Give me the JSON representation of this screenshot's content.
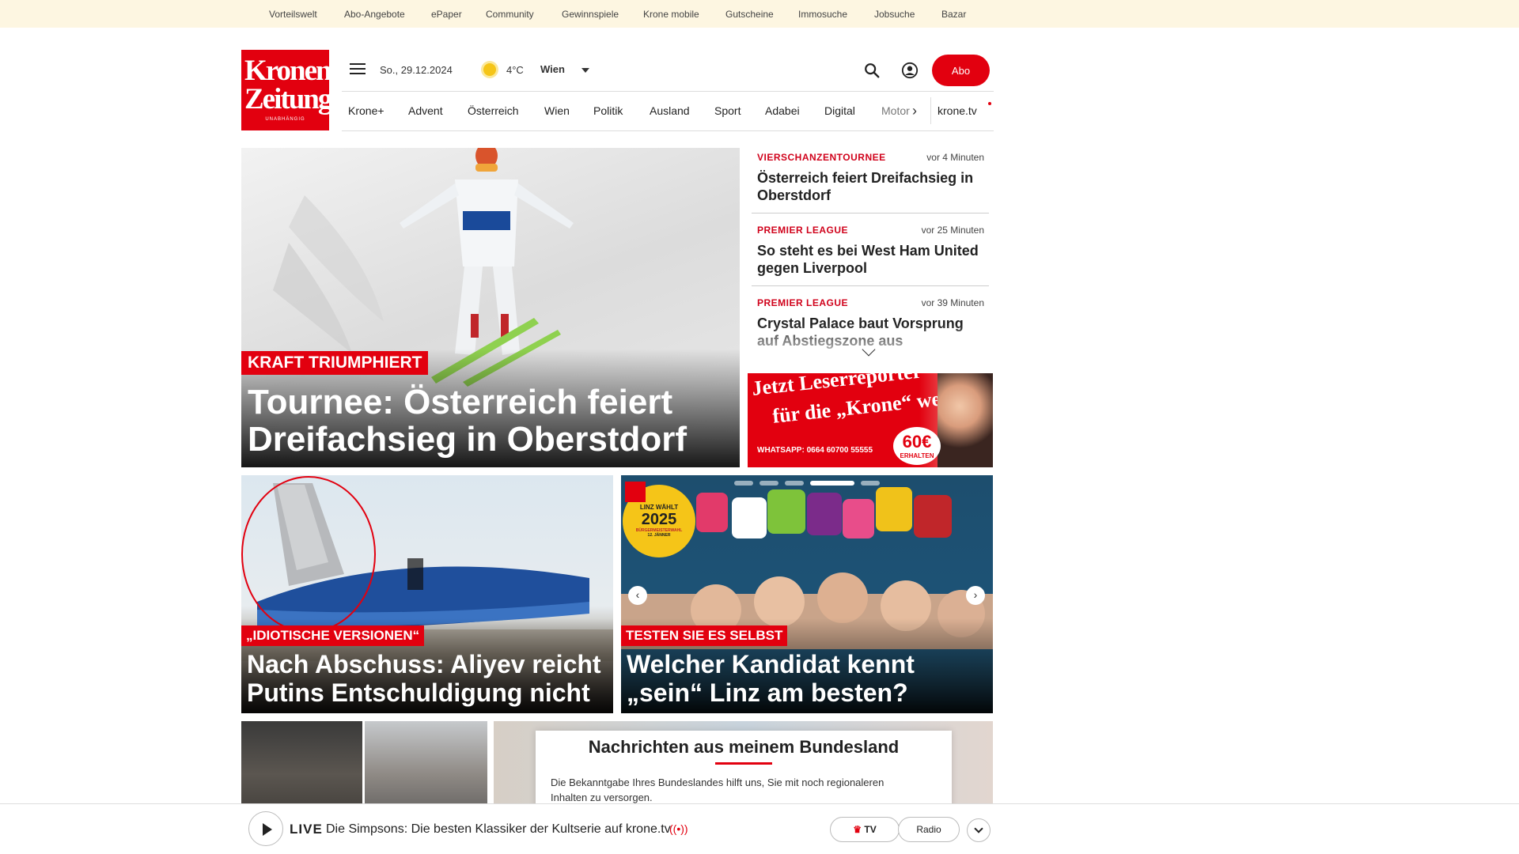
{
  "topbar": {
    "items": [
      "Vorteilswelt",
      "Abo-Angebote",
      "ePaper",
      "Community",
      "Gewinnspiele",
      "Krone mobile",
      "Gutscheine",
      "Immosuche",
      "Jobsuche",
      "Bazar"
    ]
  },
  "logo": {
    "line1": "Kronen",
    "line2": "Zeitung",
    "tagline": "UNABHÄNGIG"
  },
  "header": {
    "date": "So., 29.12.2024",
    "weather_icon": "sun-icon",
    "temperature": "4°C",
    "city": "Wien",
    "abo_label": "Abo"
  },
  "nav": {
    "items": [
      "Krone+",
      "Advent",
      "Österreich",
      "Wien",
      "Politik",
      "Ausland",
      "Sport",
      "Adabei",
      "Digital",
      "Motor"
    ],
    "extra": "krone.tv"
  },
  "hero": {
    "kicker": "KRAFT TRIUMPHIERT",
    "headline_line1": "Tournee: Österreich feiert",
    "headline_line2": "Dreifachsieg in Oberstdorf"
  },
  "sidebar": {
    "items": [
      {
        "category": "VIERSCHANZENTOURNEE",
        "time": "vor 4 Minuten",
        "title": "Österreich feiert Dreifachsieg in Oberstdorf"
      },
      {
        "category": "PREMIER LEAGUE",
        "time": "vor 25 Minuten",
        "title": "So steht es bei West Ham United gegen Liverpool"
      },
      {
        "category": "PREMIER LEAGUE",
        "time": "vor 39 Minuten",
        "title": "Crystal Palace baut Vorsprung auf Abstiegszone aus"
      }
    ]
  },
  "ad": {
    "line1": "Jetzt Leserreporter",
    "line2": "für die „Krone“ werden",
    "whatsapp": "WHATSAPP: 0664 60700 55555",
    "amount": "60€",
    "amount_note": "ERHALTEN"
  },
  "cards": [
    {
      "kicker": "„IDIOTISCHE VERSIONEN“",
      "line1": "Nach Abschuss: Aliyev reicht",
      "line2": "Putins Entschuldigung nicht"
    },
    {
      "kicker": "TESTEN SIE ES SELBST",
      "line1": "Welcher Kandidat kennt",
      "line2": "„sein“ Linz am besten?",
      "badge_line1": "LINZ WÄHLT",
      "badge_year": "2025",
      "badge_line2": "BÜRGERMEISTERWAHL",
      "badge_date": "12. JÄNNER"
    }
  ],
  "region": {
    "title": "Nachrichten aus meinem Bundesland",
    "description": "Die Bekanntgabe Ihres Bundeslandes hilft uns, Sie mit noch regionaleren Inhalten zu versorgen."
  },
  "player": {
    "live_label": "LIVE",
    "title": "Die Simpsons: Die besten Klassiker der Kultserie auf krone.tv",
    "tv_label": "TV",
    "radio_label": "Radio"
  },
  "colors": {
    "brand_red": "#e2000f",
    "topbar_bg": "#fdf6e1"
  }
}
